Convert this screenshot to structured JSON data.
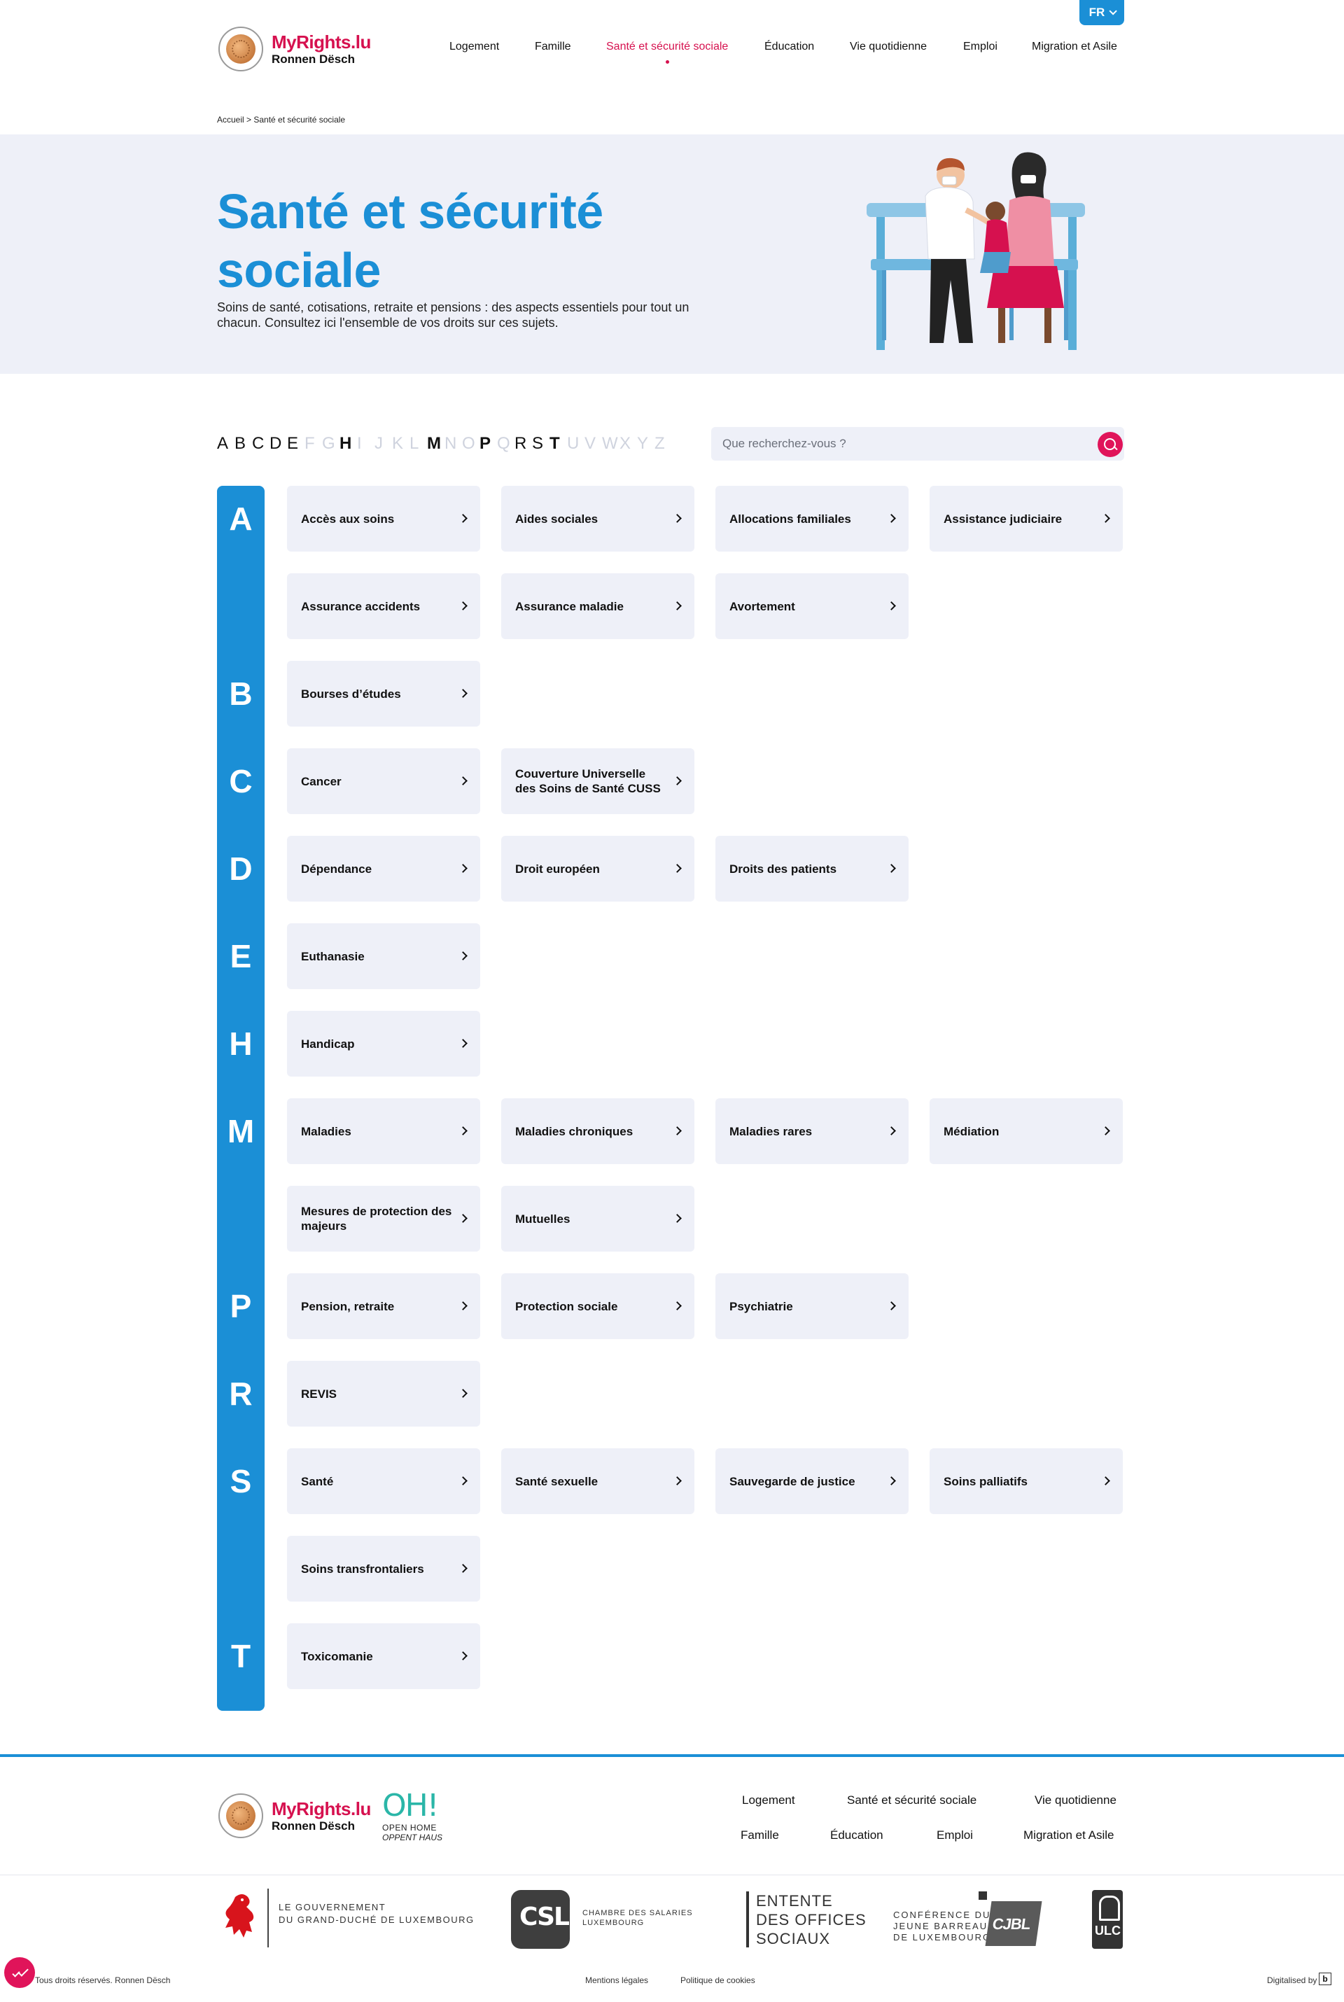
{
  "header": {
    "language": "FR",
    "brand": "MyRights.lu",
    "brand_sub": "Ronnen Dësch",
    "nav": [
      {
        "label": "Logement"
      },
      {
        "label": "Famille"
      },
      {
        "label": "Santé et sécurité sociale",
        "active": true
      },
      {
        "label": "Éducation"
      },
      {
        "label": "Vie quotidienne"
      },
      {
        "label": "Emploi"
      },
      {
        "label": "Migration et Asile"
      }
    ]
  },
  "breadcrumb": "Accueil > Santé et sécurité sociale",
  "hero": {
    "title": "Santé et sécurité sociale",
    "description": "Soins de santé, cotisations, retraite et pensions : des aspects essentiels pour tout un chacun. Consultez ici l'ensemble de vos droits sur ces sujets."
  },
  "alphabet": [
    {
      "l": "A",
      "on": true
    },
    {
      "l": "B",
      "on": true
    },
    {
      "l": "C",
      "on": true
    },
    {
      "l": "D",
      "on": true
    },
    {
      "l": "E",
      "on": true
    },
    {
      "l": "F",
      "on": false
    },
    {
      "l": "G",
      "on": false
    },
    {
      "l": "H",
      "on": true,
      "bold": true
    },
    {
      "l": "I",
      "on": false
    },
    {
      "l": "J",
      "on": false
    },
    {
      "l": "K",
      "on": false
    },
    {
      "l": "L",
      "on": false
    },
    {
      "l": "M",
      "on": true,
      "bold": true
    },
    {
      "l": "N",
      "on": false
    },
    {
      "l": "O",
      "on": false
    },
    {
      "l": "P",
      "on": true,
      "bold": true
    },
    {
      "l": "Q",
      "on": false
    },
    {
      "l": "R",
      "on": true
    },
    {
      "l": "S",
      "on": true
    },
    {
      "l": "T",
      "on": true,
      "bold": true
    },
    {
      "l": "U",
      "on": false
    },
    {
      "l": "V",
      "on": false
    },
    {
      "l": "W",
      "on": false
    },
    {
      "l": "X",
      "on": false
    },
    {
      "l": "Y",
      "on": false
    },
    {
      "l": "Z",
      "on": false
    }
  ],
  "search": {
    "placeholder": "Que recherchez-vous ?"
  },
  "index": [
    {
      "letter": "A",
      "rows": [
        [
          "Accès aux soins",
          "Aides sociales",
          "Allocations familiales",
          "Assistance judiciaire"
        ],
        [
          "Assurance accidents",
          "Assurance maladie",
          "Avortement"
        ]
      ]
    },
    {
      "letter": "B",
      "rows": [
        [
          "Bourses d’études"
        ]
      ]
    },
    {
      "letter": "C",
      "rows": [
        [
          "Cancer",
          "Couverture Universelle des Soins de Santé CUSS"
        ]
      ]
    },
    {
      "letter": "D",
      "rows": [
        [
          "Dépendance",
          "Droit européen",
          "Droits des patients"
        ]
      ]
    },
    {
      "letter": "E",
      "rows": [
        [
          "Euthanasie"
        ]
      ]
    },
    {
      "letter": "H",
      "rows": [
        [
          "Handicap"
        ]
      ]
    },
    {
      "letter": "M",
      "rows": [
        [
          "Maladies",
          "Maladies chroniques",
          "Maladies rares",
          "Médiation"
        ],
        [
          "Mesures de protection des majeurs",
          "Mutuelles"
        ]
      ]
    },
    {
      "letter": "P",
      "rows": [
        [
          "Pension, retraite",
          "Protection sociale",
          "Psychiatrie"
        ]
      ]
    },
    {
      "letter": "R",
      "rows": [
        [
          "REVIS"
        ]
      ]
    },
    {
      "letter": "S",
      "rows": [
        [
          "Santé",
          "Santé sexuelle",
          "Sauvegarde de justice",
          "Soins palliatifs"
        ],
        [
          "Soins transfrontaliers"
        ]
      ]
    },
    {
      "letter": "T",
      "rows": [
        [
          "Toxicomanie"
        ]
      ]
    }
  ],
  "footer": {
    "brand": "MyRights.lu",
    "brand_sub": "Ronnen Dësch",
    "openhome": {
      "mark_a": "OH",
      "mark_b": "!",
      "line1": "OPEN HOME",
      "line2": "OPPENT HAUS"
    },
    "nav": [
      "Logement",
      "Santé et sécurité sociale",
      "Vie quotidienne",
      "Famille",
      "Éducation",
      "Emploi",
      "Migration et Asile"
    ],
    "partners": {
      "gov": "LE GOUVERNEMENT\nDU GRAND-DUCHÉ DE LUXEMBOURG",
      "csl_mark": "CSL",
      "csl": "CHAMBRE DES SALARIES\nLUXEMBOURG",
      "eos": "ENTENTE\nDES OFFICES\nSOCIAUX",
      "cjbl": "CONFÉRENCE DU\nJEUNE BARREAU\nDE LUXEMBOURG",
      "cjbl_mark": "CJBL",
      "ulc": "ULC"
    },
    "copyright": "Tous droits réservés. Ronnen Dësch",
    "legal": "Mentions légales",
    "cookies": "Politique de cookies",
    "digitalised": "Digitalised by",
    "digitalised_mark": "b"
  }
}
